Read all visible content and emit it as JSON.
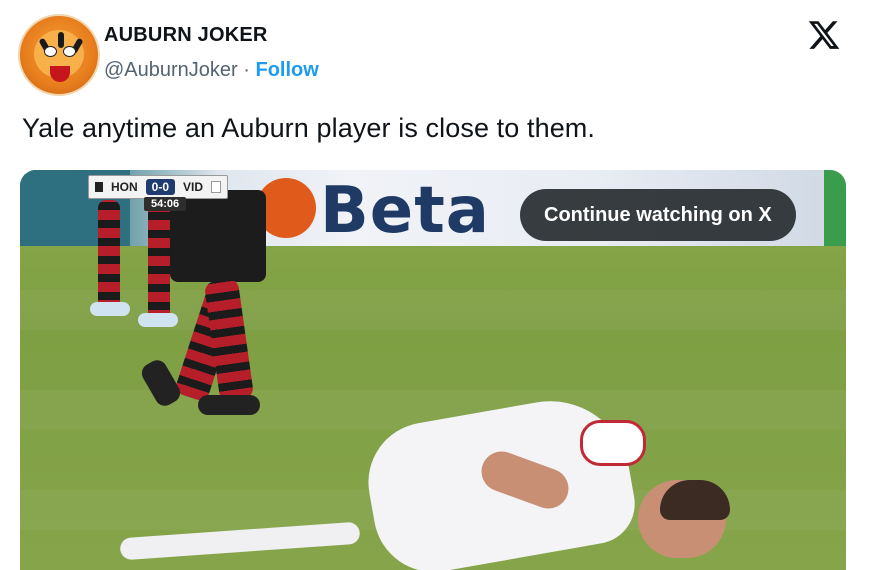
{
  "author": {
    "name": "AUBURN JOKER",
    "handle": "@AuburnJoker",
    "separator": "·",
    "follow_label": "Follow",
    "avatar_icon": "tiger-mascot-avatar"
  },
  "brand_icon": "x-logo-icon",
  "tweet": {
    "text": "Yale anytime an Auburn player is close to them."
  },
  "video": {
    "continue_label": "Continue watching on X",
    "billboard_text": "Beta",
    "scorebug": {
      "home": "HON",
      "score": "0-0",
      "away": "VID",
      "clock": "54:06"
    }
  },
  "colors": {
    "link": "#1d9bf0",
    "text": "#0f1419",
    "secondary": "#536471"
  }
}
